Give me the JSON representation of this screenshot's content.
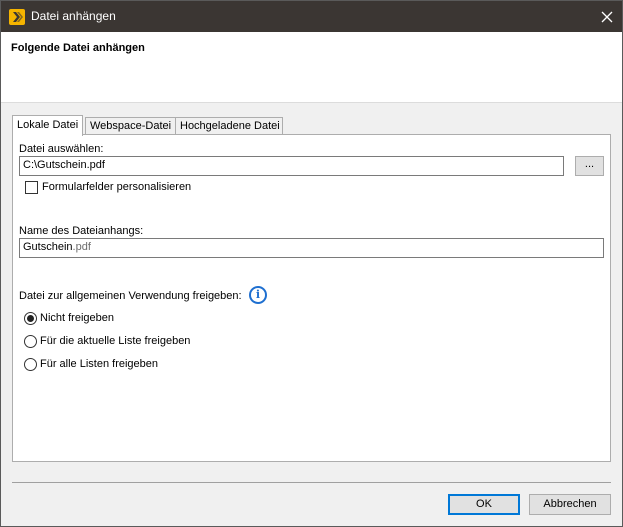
{
  "window": {
    "title": "Datei anhängen",
    "close_symbol": "✕"
  },
  "header": {
    "title": "Folgende Datei anhängen"
  },
  "tabs": [
    {
      "label": "Lokale Datei",
      "active": true
    },
    {
      "label": "Webspace-Datei",
      "active": false
    },
    {
      "label": "Hochgeladene Datei",
      "active": false
    }
  ],
  "local_file": {
    "select_label": "Datei auswählen:",
    "file_path": "C:\\Gutschein.pdf",
    "browse_label": "...",
    "personalize_label": "Formularfelder personalisieren",
    "personalize_checked": false,
    "attachment_name_label": "Name des Dateianhangs:",
    "attachment_name_base": "Gutschein",
    "attachment_name_ext": ".pdf",
    "share_label": "Datei zur allgemeinen Verwendung freigeben:",
    "info_symbol": "i",
    "share_options": [
      {
        "label": "Nicht freigeben",
        "checked": true
      },
      {
        "label": "Für die aktuelle Liste freigeben",
        "checked": false
      },
      {
        "label": "Für alle Listen freigeben",
        "checked": false
      }
    ]
  },
  "footer": {
    "ok_label": "OK",
    "cancel_label": "Abbrechen"
  },
  "colors": {
    "titlebar": "#3b3633",
    "app_icon": "#f5b400",
    "info_icon": "#1e6fd0",
    "default_button_border": "#0078d7"
  }
}
